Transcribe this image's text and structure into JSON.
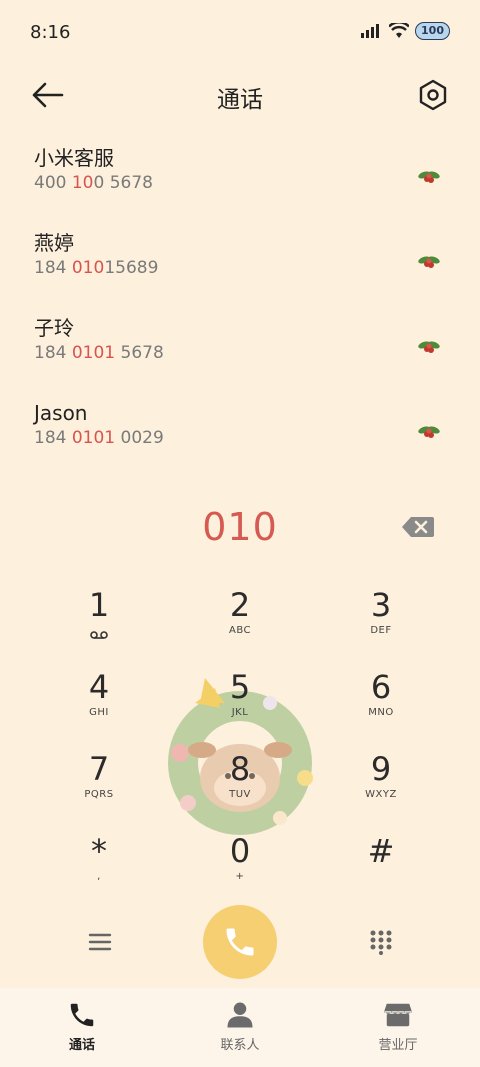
{
  "status": {
    "time": "8:16",
    "battery": "100"
  },
  "header": {
    "title": "通话"
  },
  "contacts": [
    {
      "name": "小米客服",
      "num_pre": "400 ",
      "num_hl": "10",
      "num_post": "0 5678"
    },
    {
      "name": "燕婷",
      "num_pre": "184 ",
      "num_hl": "010",
      "num_post": "15689"
    },
    {
      "name": "子玲",
      "num_pre": "184 ",
      "num_hl": "0101",
      "num_post": " 5678"
    },
    {
      "name": "Jason",
      "num_pre": "184 ",
      "num_hl": "0101",
      "num_post": " 0029"
    }
  ],
  "dialer": {
    "input": "010"
  },
  "keypad": [
    {
      "digit": "1",
      "letters": "voicemail-icon"
    },
    {
      "digit": "2",
      "letters": "ABC"
    },
    {
      "digit": "3",
      "letters": "DEF"
    },
    {
      "digit": "4",
      "letters": "GHI"
    },
    {
      "digit": "5",
      "letters": "JKL"
    },
    {
      "digit": "6",
      "letters": "MNO"
    },
    {
      "digit": "7",
      "letters": "PQRS"
    },
    {
      "digit": "8",
      "letters": "TUV"
    },
    {
      "digit": "9",
      "letters": "WXYZ"
    },
    {
      "digit": "*",
      "letters": ","
    },
    {
      "digit": "0",
      "letters": "+"
    },
    {
      "digit": "#",
      "letters": ""
    }
  ],
  "nav": {
    "calls": "通话",
    "contacts": "联系人",
    "store": "营业厅"
  },
  "colors": {
    "background": "#fdf0dd",
    "highlight": "#d9534f",
    "call_button": "#f5cf72"
  }
}
